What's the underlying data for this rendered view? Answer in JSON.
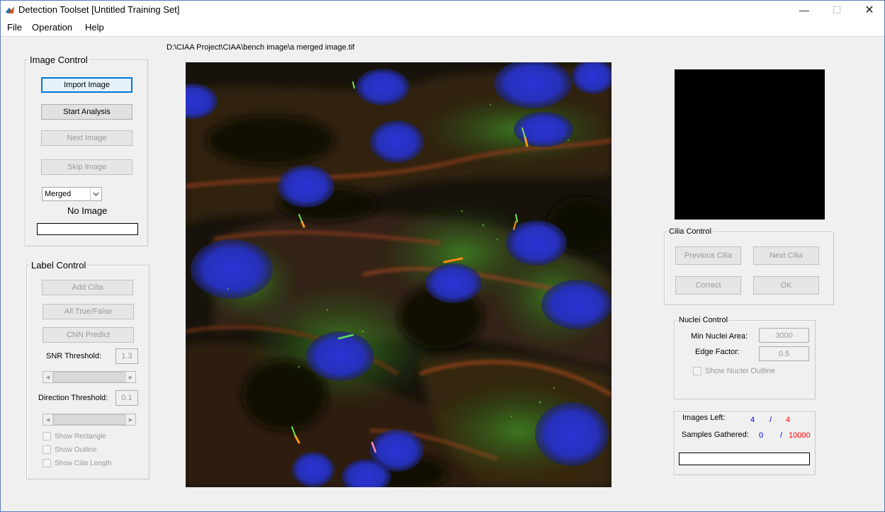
{
  "window": {
    "title": "Detection Toolset  [Untitled Training Set]",
    "controls": {
      "minimize": "—",
      "maximize": "☐",
      "close": "✕"
    }
  },
  "menu": [
    "File",
    "Operation",
    "Help"
  ],
  "image_path": "D:\\CIAA Project\\CIAA\\bench image\\a merged image.tif",
  "image_control": {
    "legend": "Image Control",
    "import_label": "Import Image",
    "start_label": "Start Analysis",
    "next_label": "Next Image",
    "skip_label": "Skip Image",
    "channel_selected": "Merged",
    "status": "No Image"
  },
  "label_control": {
    "legend": "Label Control",
    "add_label": "Add Cilia",
    "all_label": "All True/False",
    "cnn_label": "CNN Predict",
    "snr_label": "SNR Threshold:",
    "snr_value": "1.3",
    "direction_label": "Direction Threshold:",
    "direction_value": "0.1",
    "show_rectangle": "Show Rectangle",
    "show_outline": "Show Outline",
    "show_length": "Show Cilia Length"
  },
  "cilia_control": {
    "legend": "Cilia Control",
    "prev_label": "Previous Cilia",
    "next_label": "Next Cilia",
    "correct_label": "Correct",
    "ok_label": "OK"
  },
  "nuclei_control": {
    "legend": "Nuclei Control",
    "min_area_label": "Min Nuclei Area:",
    "min_area_value": "3000",
    "edge_label": "Edge Factor:",
    "edge_value": "0.5",
    "show_outline": "Show Nuclei Outline"
  },
  "stats": {
    "images_left_label": "Images Left:",
    "images_left_current": "4",
    "images_left_sep": "/",
    "images_left_total": "4",
    "samples_label": "Samples Gathered:",
    "samples_current": "0",
    "samples_sep": "/",
    "samples_total": "10000"
  },
  "colors": {
    "accent": "#0078d7",
    "counter_blue": "#0000ff",
    "counter_red": "#ff0000",
    "nucleus": "#2a33c8",
    "cilium": "#ff9a10",
    "membrane": "#b0481e",
    "cytoplasm": "#2f7a1c"
  }
}
